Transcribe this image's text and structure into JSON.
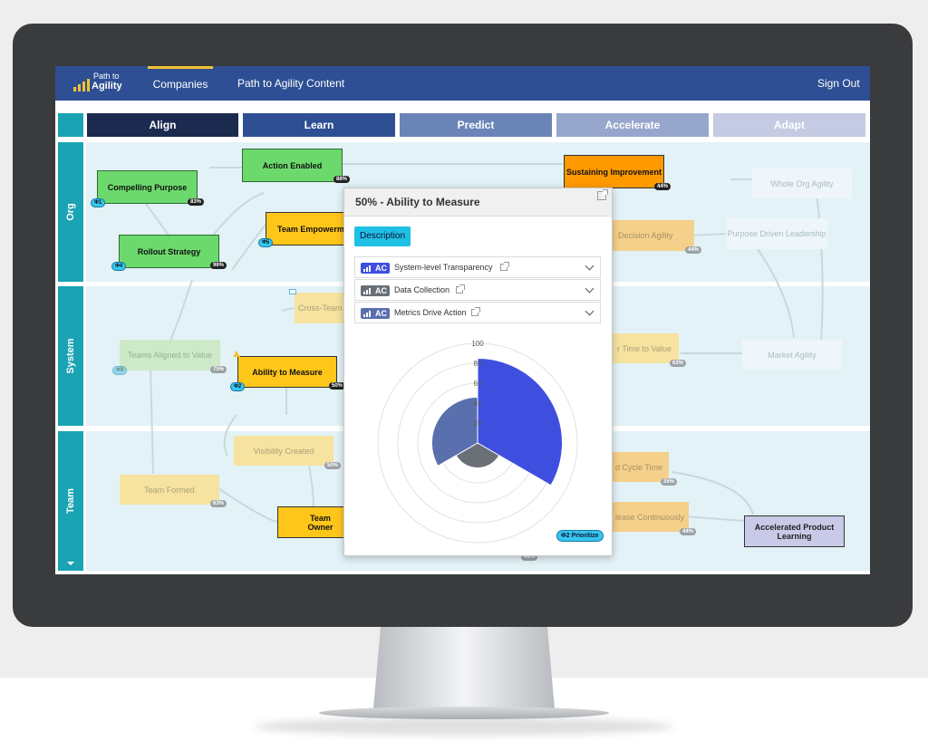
{
  "nav": {
    "logo_line1": "Path to",
    "logo_line2": "Agility",
    "companies": "Companies",
    "content": "Path to Agility Content",
    "sign_out": "Sign Out"
  },
  "stages": [
    "Align",
    "Learn",
    "Predict",
    "Accelerate",
    "Adapt"
  ],
  "rows": [
    "Org",
    "System",
    "Team"
  ],
  "nodes": {
    "compelling_purpose": {
      "label": "Compelling Purpose",
      "pct": "83%",
      "badge": "Φ1"
    },
    "rollout_strategy": {
      "label": "Rollout Strategy",
      "pct": "96%",
      "badge": "Φ4"
    },
    "action_enabled": {
      "label": "Action Enabled",
      "pct": "88%"
    },
    "team_empowerment": {
      "label": "Team Empowerm",
      "badge": "Φ5"
    },
    "sustaining_improvement": {
      "label": "Sustaining Improvement",
      "pct": "44%"
    },
    "whole_org_agility": {
      "label": "Whole Org Agility"
    },
    "decision_agility": {
      "label": "Decision Agility",
      "pct": "44%"
    },
    "purpose_driven_leadership": {
      "label": "Purpose Driven Leadership"
    },
    "cross_team": {
      "label": "Cross-Team"
    },
    "teams_aligned": {
      "label": "Teams Aligned to Value",
      "pct": "75%",
      "badge": "Φ3"
    },
    "ability_to_measure": {
      "label": "Ability to Measure",
      "pct": "50%",
      "badge": "Φ2"
    },
    "time_to_value": {
      "label": "r Time to Value",
      "pct": "63%"
    },
    "market_agility": {
      "label": "Market Agility"
    },
    "visibility_created": {
      "label": "Visibility Created",
      "pct": "50%"
    },
    "team_formed": {
      "label": "Team Formed",
      "pct": "63%"
    },
    "team_ownership": {
      "label": "Team Owner"
    },
    "cycle_time": {
      "label": "d Cycle Time",
      "pct": "35%"
    },
    "release_continuously": {
      "label": "lease Continuously",
      "pct": "44%"
    },
    "hidden_pct": {
      "pct": "44%"
    },
    "accelerated_product_learning": {
      "label_line1": "Accelerated Product",
      "label_line2": "Learning"
    }
  },
  "modal": {
    "title": "50% - Ability to Measure",
    "description_button": "Description",
    "criteria": [
      {
        "tag": "AC",
        "name": "System-level Transparency",
        "color": "#3e4fe0"
      },
      {
        "tag": "AC",
        "name": "Data Collection",
        "color": "#6b7078"
      },
      {
        "tag": "AC",
        "name": "Metrics Drive Action",
        "color": "#5a6fae"
      }
    ],
    "prioritize_badge": "Φ2 Prioritize"
  },
  "chart_data": {
    "type": "polar-area",
    "r_ticks": [
      "20",
      "40",
      "60",
      "80",
      "100"
    ],
    "rlim": [
      0,
      100
    ],
    "slices": [
      {
        "label": "System-level Transparency",
        "value": 85,
        "color": "#3e4fe0"
      },
      {
        "label": "Data Collection",
        "value": 25,
        "color": "#6b7078"
      },
      {
        "label": "Metrics Drive Action",
        "value": 46,
        "color": "#5a6fae"
      }
    ]
  }
}
